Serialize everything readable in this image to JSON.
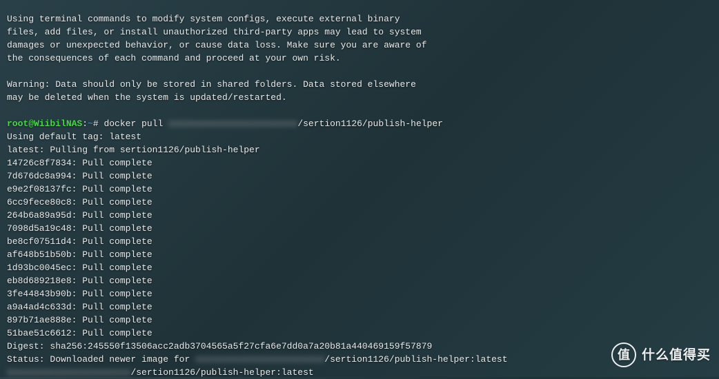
{
  "warning": {
    "l1": "Using terminal commands to modify system configs, execute external binary",
    "l2": "files, add files, or install unauthorized third-party apps may lead to system",
    "l3": "damages or unexpected behavior, or cause data loss. Make sure you are aware of",
    "l4": "the consequences of each command and proceed at your own risk.",
    "l5": "Warning: Data should only be stored in shared folders. Data stored elsewhere",
    "l6": "may be deleted when the system is updated/restarted."
  },
  "prompt": {
    "user": "root@WiibilNAS",
    "sep": ":",
    "path": "~",
    "hash": "# ",
    "cmd_pre": "docker pull ",
    "redacted": "xxxxxxxxxxxxxxxxxxxxxxxx",
    "cmd_post": "/sertion1126/publish-helper"
  },
  "pull": {
    "tag": "Using default tag: latest",
    "from": "latest: Pulling from sertion1126/publish-helper"
  },
  "layers": [
    "14726c8f7834: Pull complete",
    "7d676dc8a994: Pull complete",
    "e9e2f08137fc: Pull complete",
    "6cc9fece80c8: Pull complete",
    "264b6a89a95d: Pull complete",
    "7098d5a19c48: Pull complete",
    "be8cf07511d4: Pull complete",
    "af648b51b50b: Pull complete",
    "1d93bc0045ec: Pull complete",
    "eb8d689218e8: Pull complete",
    "3fe44843b90b: Pull complete",
    "a9a4ad4c633d: Pull complete",
    "897b71ae888e: Pull complete",
    "51bae51c6612: Pull complete"
  ],
  "digest": "Digest: sha256:245550f13506acc2adb3704565a5f27cfa6e7dd0a7a20b81a440469159f57879",
  "status": {
    "pre": "Status: Downloaded newer image for ",
    "redacted": "xxxxxxxxxxxxxxxxxxxxxxxx",
    "post": "/sertion1126/publish-helper:latest"
  },
  "finalline": {
    "redacted": "xxxxxxxxxxxxxxxxxxxxxxx",
    "post": "/sertion1126/publish-helper:latest"
  },
  "watermark": {
    "icon": "值",
    "text": "什么值得买"
  }
}
